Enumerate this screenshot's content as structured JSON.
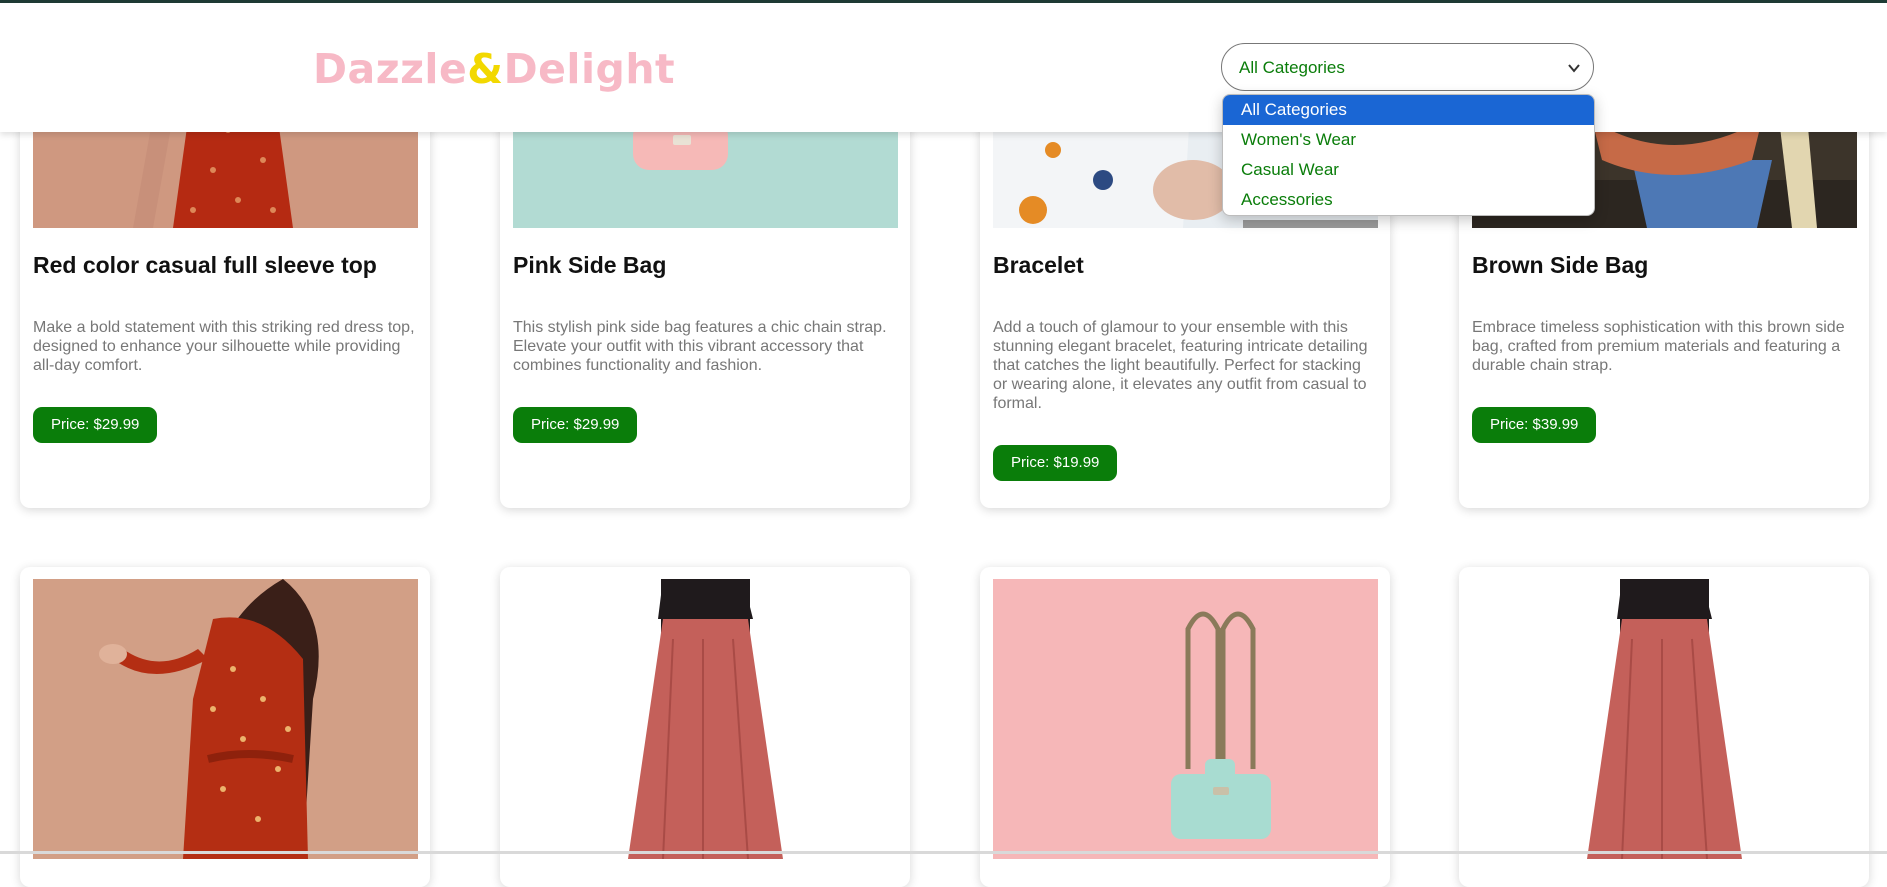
{
  "header": {
    "logo_part1": "Dazzle",
    "logo_amp": "&",
    "logo_part2": "Delight",
    "category_select": {
      "value": "All Categories",
      "options": [
        "All Categories",
        "Women's Wear",
        "Casual Wear",
        "Accessories"
      ]
    }
  },
  "products": [
    {
      "title": "Red color casual full sleeve top",
      "description": "Make a bold statement with this striking red dress top, designed to enhance your silhouette while providing all-day comfort.",
      "price": "Price: $29.99"
    },
    {
      "title": "Pink Side Bag",
      "description": "This stylish pink side bag features a chic chain strap. Elevate your outfit with this vibrant accessory that combines functionality and fashion.",
      "price": "Price: $29.99"
    },
    {
      "title": "Bracelet",
      "description": "Add a touch of glamour to your ensemble with this stunning elegant bracelet, featuring intricate detailing that catches the light beautifully. Perfect for stacking or wearing alone, it elevates any outfit from casual to formal.",
      "price": "Price: $19.99"
    },
    {
      "title": "Brown Side Bag",
      "description": "Embrace timeless sophistication with this brown side bag, crafted from premium materials and featuring a durable chain strap.",
      "price": "Price: $39.99"
    }
  ],
  "colors": {
    "accent_green": "#0a7d0a",
    "logo_pink": "#f7b9c6",
    "logo_amp_yellow": "#f2d800",
    "selected_option": "#1a66d4"
  },
  "icons": [
    "chevron-down-icon"
  ]
}
